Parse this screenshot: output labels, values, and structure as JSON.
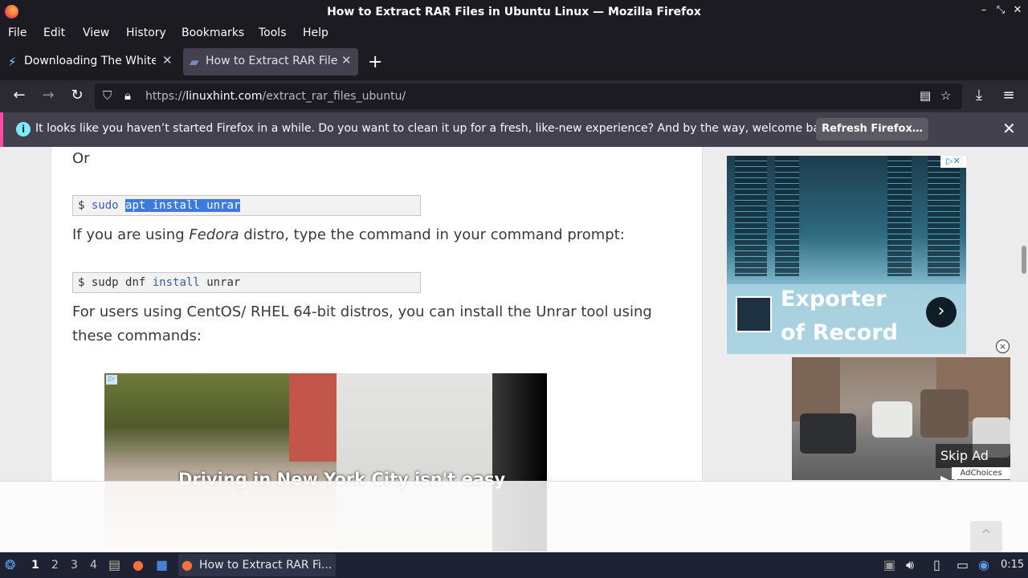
{
  "window": {
    "title": "How to Extract RAR Files in Ubuntu Linux — Mozilla Firefox"
  },
  "menu": [
    "File",
    "Edit",
    "View",
    "History",
    "Bookmarks",
    "Tools",
    "Help"
  ],
  "tabs": [
    {
      "label": "Downloading The White",
      "active": false
    },
    {
      "label": "How to Extract RAR Files",
      "active": true
    }
  ],
  "urlbar": {
    "scheme": "https://",
    "host": "linuxhint.com",
    "path": "/extract_rar_files_ubuntu/"
  },
  "notification": {
    "message": "It looks like you haven’t started Firefox in a while. Do you want to clean it up for a fresh, like-new experience? And by the way, welcome back!",
    "button": "Refresh Firefox…"
  },
  "article": {
    "or_text": "Or",
    "code1": {
      "prompt": "$",
      "cmd": "sudo",
      "selected": "apt install unrar"
    },
    "fedora_pre": "If you are using ",
    "fedora_italic": "Fedora",
    "fedora_post": " distro, type the command in your command prompt:",
    "code2": {
      "prompt": "$",
      "cmd": "sudp dnf",
      "kw": "install",
      "arg": "unrar"
    },
    "centos_line1": "For users using CentOS/ RHEL 64-bit distros, you can install the Unrar tool using",
    "centos_line2": "these commands:",
    "video_caption": "Driving in New York City isn't easy"
  },
  "ads": {
    "ad1_headline": "Exporter of Record",
    "skip_label": "Skip Ad",
    "adchoices": "AdChoices"
  },
  "taskbar": {
    "workspaces": [
      "1",
      "2",
      "3",
      "4"
    ],
    "task_label": "How to Extract RAR Fi...",
    "clock": "0:15"
  }
}
